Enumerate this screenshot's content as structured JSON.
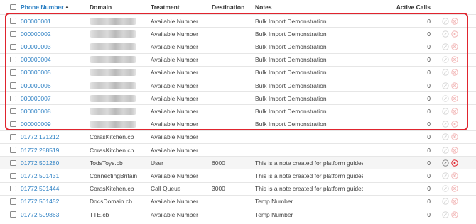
{
  "table": {
    "headers": {
      "phone": "Phone Number",
      "domain": "Domain",
      "treatment": "Treatment",
      "destination": "Destination",
      "notes": "Notes",
      "active_calls": "Active Calls"
    },
    "sort_icon": "sort-ascending-icon",
    "rows": [
      {
        "phone": "000000001",
        "domain": "",
        "treatment": "Available Number",
        "destination": "",
        "notes": "Bulk Import Demonstration",
        "calls": "0",
        "active": false
      },
      {
        "phone": "000000002",
        "domain": "",
        "treatment": "Available Number",
        "destination": "",
        "notes": "Bulk Import Demonstration",
        "calls": "0",
        "active": false
      },
      {
        "phone": "000000003",
        "domain": "",
        "treatment": "Available Number",
        "destination": "",
        "notes": "Bulk Import Demonstration",
        "calls": "0",
        "active": false
      },
      {
        "phone": "000000004",
        "domain": "",
        "treatment": "Available Number",
        "destination": "",
        "notes": "Bulk Import Demonstration",
        "calls": "0",
        "active": false
      },
      {
        "phone": "000000005",
        "domain": "",
        "treatment": "Available Number",
        "destination": "",
        "notes": "Bulk Import Demonstration",
        "calls": "0",
        "active": false
      },
      {
        "phone": "000000006",
        "domain": "",
        "treatment": "Available Number",
        "destination": "",
        "notes": "Bulk Import Demonstration",
        "calls": "0",
        "active": false
      },
      {
        "phone": "000000007",
        "domain": "",
        "treatment": "Available Number",
        "destination": "",
        "notes": "Bulk Import Demonstration",
        "calls": "0",
        "active": false
      },
      {
        "phone": "000000008",
        "domain": "",
        "treatment": "Available Number",
        "destination": "",
        "notes": "Bulk Import Demonstration",
        "calls": "0",
        "active": false
      },
      {
        "phone": "000000009",
        "domain": "",
        "treatment": "Available Number",
        "destination": "",
        "notes": "Bulk Import Demonstration",
        "calls": "0",
        "active": false
      },
      {
        "phone": "01772 121212",
        "domain": "CorasKitchen.cb",
        "treatment": "Available Number",
        "destination": "",
        "notes": "",
        "calls": "0",
        "active": false
      },
      {
        "phone": "01772 288519",
        "domain": "CorasKitchen.cb",
        "treatment": "Available Number",
        "destination": "",
        "notes": "",
        "calls": "0",
        "active": false
      },
      {
        "phone": "01772 501280",
        "domain": "TodsToys.cb",
        "treatment": "User",
        "destination": "6000",
        "notes": "This is a note created for platform guides!",
        "calls": "0",
        "active": true
      },
      {
        "phone": "01772 501431",
        "domain": "ConnectingBritain",
        "treatment": "Available Number",
        "destination": "",
        "notes": "This is a note created for platform guides!",
        "calls": "0",
        "active": false
      },
      {
        "phone": "01772 501444",
        "domain": "CorasKitchen.cb",
        "treatment": "Call Queue",
        "destination": "3000",
        "notes": "This is a note created for platform guides!",
        "calls": "0",
        "active": false
      },
      {
        "phone": "01772 501452",
        "domain": "DocsDomain.cb",
        "treatment": "Available Number",
        "destination": "",
        "notes": "Temp Number",
        "calls": "0",
        "active": false
      },
      {
        "phone": "01772 509863",
        "domain": "TTE.cb",
        "treatment": "Available Number",
        "destination": "",
        "notes": "Temp Number",
        "calls": "0",
        "active": false
      }
    ]
  },
  "icons": {
    "edit": "edit-icon",
    "delete": "delete-icon"
  },
  "colors": {
    "link": "#2b7fc3",
    "highlight_border": "#e0242e",
    "delete_active": "#e0242e",
    "icon_inactive": "#d8d8d8"
  }
}
